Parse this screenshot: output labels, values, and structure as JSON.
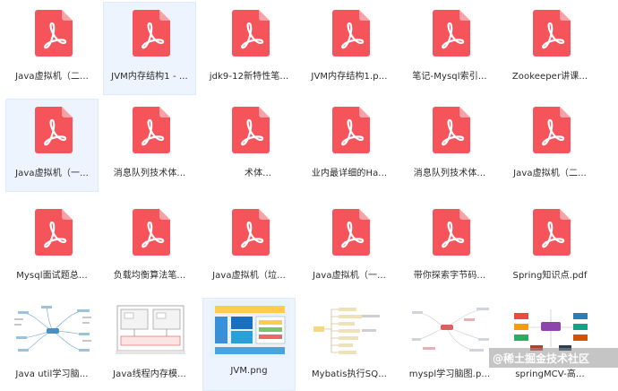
{
  "files": [
    {
      "label": "Java虚拟机（二...",
      "type": "pdf"
    },
    {
      "label": "JVM内存结构1 - ...",
      "type": "pdf",
      "selected": true
    },
    {
      "label": "jdk9-12新特性笔...",
      "type": "pdf"
    },
    {
      "label": "JVM内存结构1.p...",
      "type": "pdf"
    },
    {
      "label": "笔记-Mysql索引...",
      "type": "pdf"
    },
    {
      "label": "Zookeeper讲课...",
      "type": "pdf"
    },
    {
      "label": "Java虚拟机（一...",
      "type": "pdf",
      "selected": true
    },
    {
      "label": "消息队列技术体...",
      "type": "pdf"
    },
    {
      "label": "术体...",
      "type": "pdf",
      "offset": true
    },
    {
      "label": "业内最详细的Ha...",
      "type": "pdf"
    },
    {
      "label": "消息队列技术体...",
      "type": "pdf"
    },
    {
      "label": "Java虚拟机（二...",
      "type": "pdf"
    },
    {
      "label": "Mysql面试题总...",
      "type": "pdf"
    },
    {
      "label": "负载均衡算法笔...",
      "type": "pdf"
    },
    {
      "label": "Java虚拟机（垃...",
      "type": "pdf"
    },
    {
      "label": "Java虚拟机（一...",
      "type": "pdf"
    },
    {
      "label": "带你探索字节码...",
      "type": "pdf"
    },
    {
      "label": "Spring知识点.pdf",
      "type": "pdf"
    },
    {
      "label": "Java util学习脑...",
      "type": "img",
      "thumb": "mindmap"
    },
    {
      "label": "Java线程内存模...",
      "type": "img",
      "thumb": "diagram"
    },
    {
      "label": "JVM.png",
      "type": "img",
      "thumb": "jvm",
      "selected": true
    },
    {
      "label": "Mybatis执行SQ...",
      "type": "img",
      "thumb": "tree"
    },
    {
      "label": "myspl学习脑图.p...",
      "type": "img",
      "thumb": "mindmap2"
    },
    {
      "label": "springMCV-高...",
      "type": "img",
      "thumb": "colorful"
    }
  ],
  "watermark": "@稀土掘金技术社区",
  "colors": {
    "pdf_red": "#f4545a",
    "selection_bg": "#eef4fd"
  }
}
